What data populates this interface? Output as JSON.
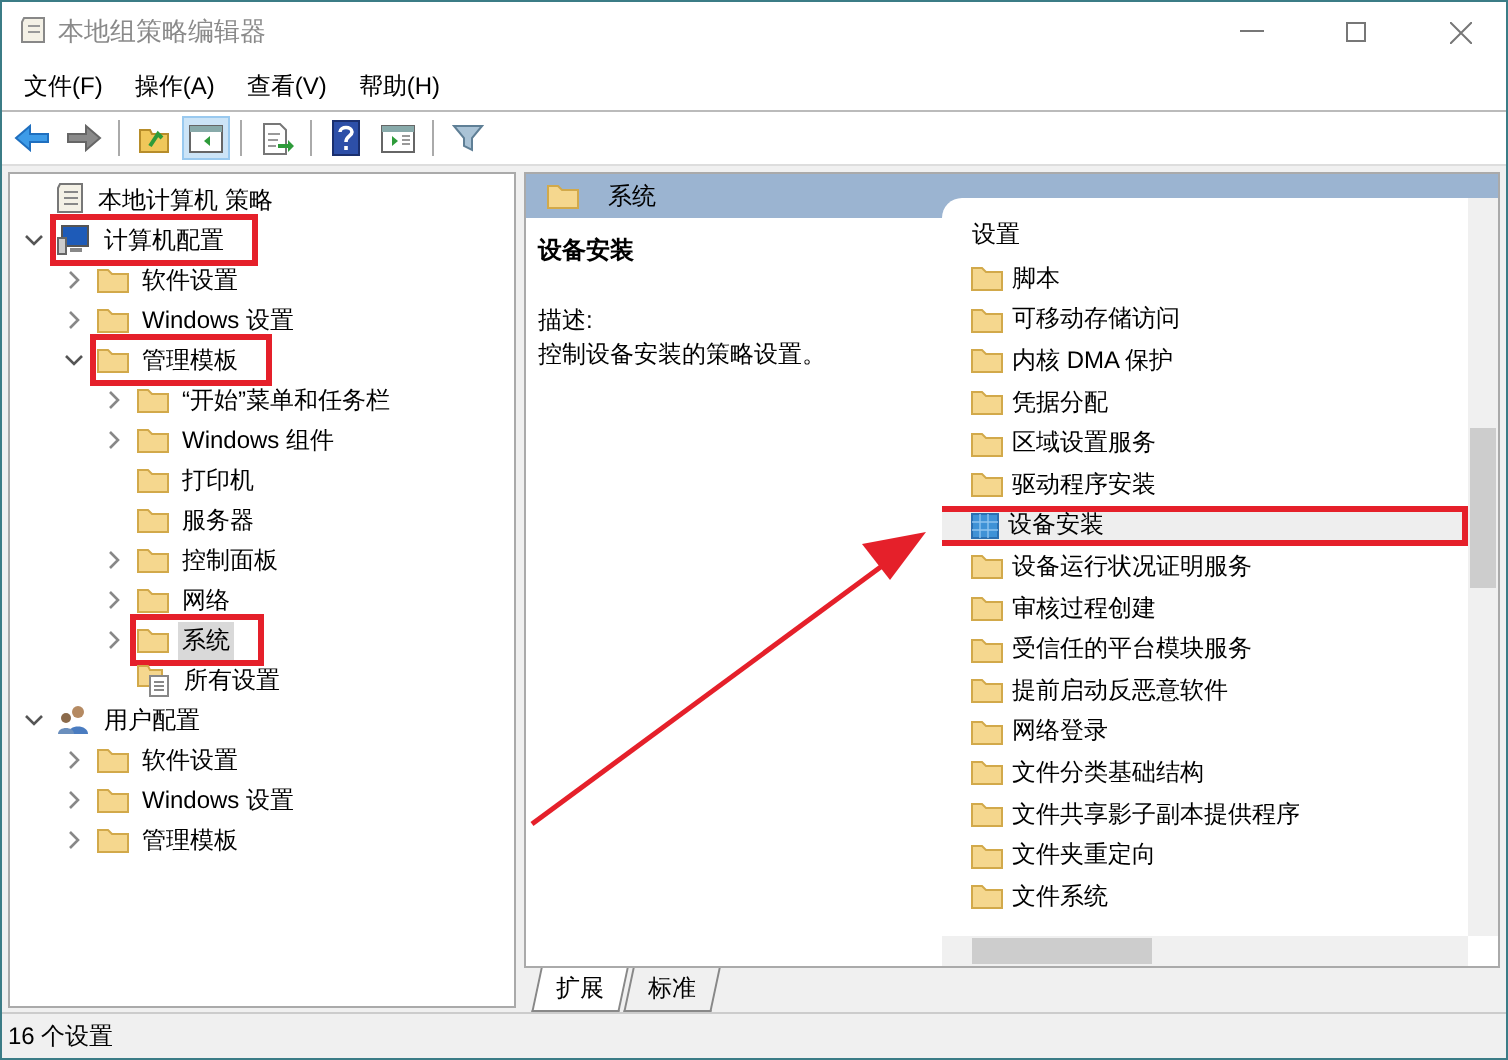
{
  "window": {
    "title": "本地组策略编辑器"
  },
  "menu": [
    "文件(F)",
    "操作(A)",
    "查看(V)",
    "帮助(H)"
  ],
  "toolbar": [
    {
      "kind": "back",
      "pressed": false
    },
    {
      "kind": "forward",
      "pressed": false
    },
    {
      "kind": "separator"
    },
    {
      "kind": "up",
      "pressed": false
    },
    {
      "kind": "tree",
      "pressed": true
    },
    {
      "kind": "separator"
    },
    {
      "kind": "export",
      "pressed": false
    },
    {
      "kind": "separator"
    },
    {
      "kind": "help",
      "pressed": false
    },
    {
      "kind": "pane",
      "pressed": false
    },
    {
      "kind": "separator"
    },
    {
      "kind": "filter",
      "pressed": false
    }
  ],
  "tree": [
    {
      "label": "本地计算机 策略",
      "kind": "policy",
      "children": [
        {
          "label": "计算机配置",
          "kind": "computer",
          "expanded": true,
          "selected": false,
          "highlighted": true,
          "children": [
            {
              "label": "软件设置",
              "kind": "folder",
              "expanded": false,
              "selected": false,
              "highlighted": false
            },
            {
              "label": "Windows 设置",
              "kind": "folder",
              "expanded": false,
              "selected": false,
              "highlighted": false
            },
            {
              "label": "管理模板",
              "kind": "folder",
              "expanded": true,
              "selected": false,
              "highlighted": true,
              "children": [
                {
                  "label": "“开始”菜单和任务栏",
                  "kind": "folder",
                  "expanded": false,
                  "selected": false,
                  "highlighted": false
                },
                {
                  "label": "Windows 组件",
                  "kind": "folder",
                  "expanded": false,
                  "selected": false,
                  "highlighted": false
                },
                {
                  "label": "打印机",
                  "kind": "folder",
                  "selected": false,
                  "highlighted": false
                },
                {
                  "label": "服务器",
                  "kind": "folder",
                  "selected": false,
                  "highlighted": false
                },
                {
                  "label": "控制面板",
                  "kind": "folder",
                  "expanded": false,
                  "selected": false,
                  "highlighted": false
                },
                {
                  "label": "网络",
                  "kind": "folder",
                  "expanded": false,
                  "selected": false,
                  "highlighted": false
                },
                {
                  "label": "系统",
                  "kind": "folder",
                  "expanded": false,
                  "selected": true,
                  "highlighted": true
                },
                {
                  "label": "所有设置",
                  "kind": "settings",
                  "selected": false,
                  "highlighted": false
                }
              ]
            }
          ]
        },
        {
          "label": "用户配置",
          "kind": "user",
          "expanded": true,
          "selected": false,
          "highlighted": false,
          "children": [
            {
              "label": "软件设置",
              "kind": "folder",
              "expanded": false,
              "selected": false,
              "highlighted": false
            },
            {
              "label": "Windows 设置",
              "kind": "folder",
              "expanded": false,
              "selected": false,
              "highlighted": false
            },
            {
              "label": "管理模板",
              "kind": "folder",
              "expanded": false,
              "selected": false,
              "highlighted": false
            }
          ]
        }
      ]
    }
  ],
  "details": {
    "header": "系统",
    "title": "设备安装",
    "description_label": "描述:",
    "description": "控制设备安装的策略设置。"
  },
  "list": {
    "column": "设置",
    "items": [
      {
        "label": "脚本",
        "kind": "folder",
        "selected": false,
        "highlighted": false
      },
      {
        "label": "可移动存储访问",
        "kind": "folder",
        "selected": false,
        "highlighted": false
      },
      {
        "label": "内核 DMA 保护",
        "kind": "folder",
        "selected": false,
        "highlighted": false
      },
      {
        "label": "凭据分配",
        "kind": "folder",
        "selected": false,
        "highlighted": false
      },
      {
        "label": "区域设置服务",
        "kind": "folder",
        "selected": false,
        "highlighted": false
      },
      {
        "label": "驱动程序安装",
        "kind": "folder",
        "selected": false,
        "highlighted": false
      },
      {
        "label": "设备安装",
        "kind": "group",
        "selected": true,
        "highlighted": true
      },
      {
        "label": "设备运行状况证明服务",
        "kind": "folder",
        "selected": false,
        "highlighted": false
      },
      {
        "label": "审核过程创建",
        "kind": "folder",
        "selected": false,
        "highlighted": false
      },
      {
        "label": "受信任的平台模块服务",
        "kind": "folder",
        "selected": false,
        "highlighted": false
      },
      {
        "label": "提前启动反恶意软件",
        "kind": "folder",
        "selected": false,
        "highlighted": false
      },
      {
        "label": "网络登录",
        "kind": "folder",
        "selected": false,
        "highlighted": false
      },
      {
        "label": "文件分类基础结构",
        "kind": "folder",
        "selected": false,
        "highlighted": false
      },
      {
        "label": "文件共享影子副本提供程序",
        "kind": "folder",
        "selected": false,
        "highlighted": false
      },
      {
        "label": "文件夹重定向",
        "kind": "folder",
        "selected": false,
        "highlighted": false
      },
      {
        "label": "文件系统",
        "kind": "folder",
        "selected": false,
        "highlighted": false
      }
    ]
  },
  "view_tabs": [
    {
      "label": "扩展",
      "selected": true
    },
    {
      "label": "标准",
      "selected": false
    }
  ],
  "annotation_arrow": true,
  "status_bar": "16 个设置"
}
